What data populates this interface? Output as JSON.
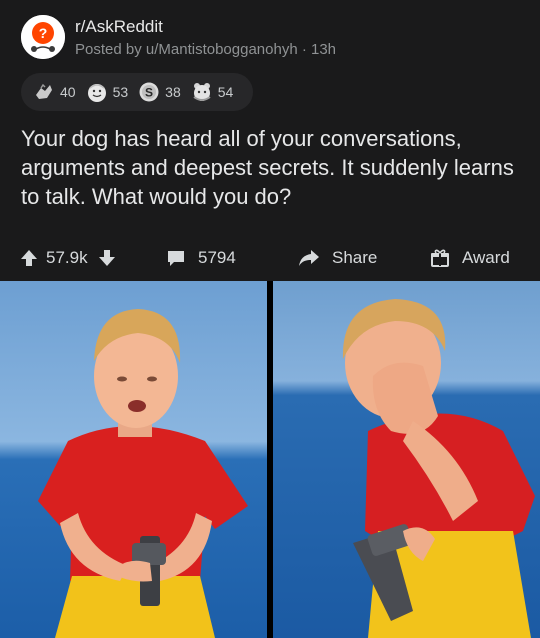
{
  "post": {
    "subreddit": "r/AskReddit",
    "posted_by": "Posted by u/Mantistobogganohyh · 13h",
    "awards": [
      {
        "icon": "helpful-award-icon",
        "count": "40"
      },
      {
        "icon": "wholesome-award-icon",
        "count": "53"
      },
      {
        "icon": "silver-coin-award-icon",
        "count": "38"
      },
      {
        "icon": "hugz-award-icon",
        "count": "54"
      }
    ],
    "title": "Your dog has heard all of your conversations, arguments and deepest secrets. It suddenly learns to talk. What would you do?",
    "votes": "57.9k",
    "comments": "5794",
    "share_label": "Share",
    "award_label": "Award"
  },
  "colors": {
    "post_background": "#1a1a1b",
    "award_pill": "#272729",
    "text": "#d7dadc",
    "meta_text": "#8f9294"
  }
}
